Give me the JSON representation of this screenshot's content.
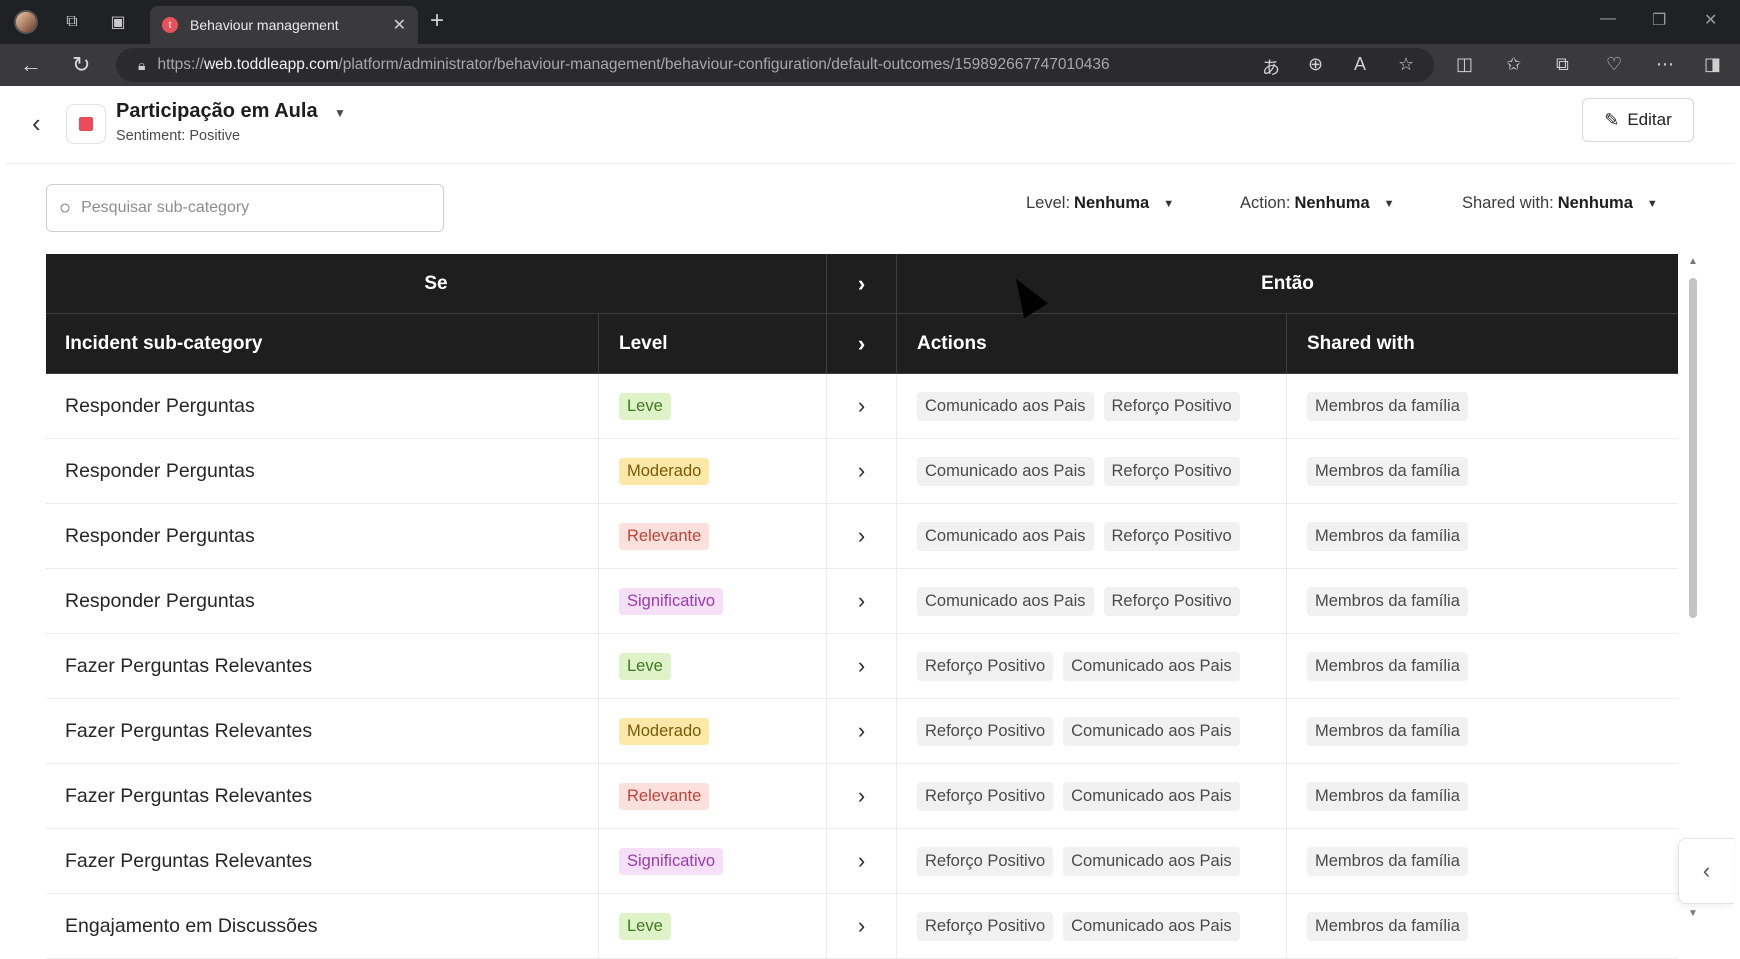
{
  "browser": {
    "tab_title": "Behaviour management",
    "tab_favicon_letter": "t",
    "url_scheme": "https://",
    "url_host": "web.toddleapp.com",
    "url_path": "/platform/administrator/behaviour-management/behaviour-configuration/default-outcomes/159892667747010436"
  },
  "header": {
    "title": "Participação em Aula",
    "sentiment": "Sentiment: Positive",
    "edit_label": "Editar",
    "category_color": "#ef4a5b"
  },
  "search": {
    "placeholder": "Pesquisar sub-category",
    "value": ""
  },
  "filters": {
    "level_label": "Level:",
    "level_value": "Nenhuma",
    "action_label": "Action:",
    "action_value": "Nenhuma",
    "shared_label": "Shared with:",
    "shared_value": "Nenhuma"
  },
  "table": {
    "group_if": "Se",
    "group_then": "Então",
    "col_subcategory": "Incident sub-category",
    "col_level": "Level",
    "col_actions": "Actions",
    "col_shared": "Shared with",
    "rows": [
      {
        "sub": "Responder Perguntas",
        "level": "Leve",
        "actions": [
          "Comunicado aos Pais",
          "Reforço Positivo"
        ],
        "shared": "Membros da família"
      },
      {
        "sub": "Responder Perguntas",
        "level": "Moderado",
        "actions": [
          "Comunicado aos Pais",
          "Reforço Positivo"
        ],
        "shared": "Membros da família"
      },
      {
        "sub": "Responder Perguntas",
        "level": "Relevante",
        "actions": [
          "Comunicado aos Pais",
          "Reforço Positivo"
        ],
        "shared": "Membros da família"
      },
      {
        "sub": "Responder Perguntas",
        "level": "Significativo",
        "actions": [
          "Comunicado aos Pais",
          "Reforço Positivo"
        ],
        "shared": "Membros da família"
      },
      {
        "sub": "Fazer Perguntas Relevantes",
        "level": "Leve",
        "actions": [
          "Reforço Positivo",
          "Comunicado aos Pais"
        ],
        "shared": "Membros da família"
      },
      {
        "sub": "Fazer Perguntas Relevantes",
        "level": "Moderado",
        "actions": [
          "Reforço Positivo",
          "Comunicado aos Pais"
        ],
        "shared": "Membros da família"
      },
      {
        "sub": "Fazer Perguntas Relevantes",
        "level": "Relevante",
        "actions": [
          "Reforço Positivo",
          "Comunicado aos Pais"
        ],
        "shared": "Membros da família"
      },
      {
        "sub": "Fazer Perguntas Relevantes",
        "level": "Significativo",
        "actions": [
          "Reforço Positivo",
          "Comunicado aos Pais"
        ],
        "shared": "Membros da família"
      },
      {
        "sub": "Engajamento em Discussões",
        "level": "Leve",
        "actions": [
          "Reforço Positivo",
          "Comunicado aos Pais"
        ],
        "shared": "Membros da família"
      }
    ]
  },
  "icons": {
    "back": "back-arrow-icon",
    "search": "search-icon",
    "edit": "pencil-icon",
    "row_arrow": "chevron-right-icon",
    "collapse": "chevron-left-icon"
  }
}
